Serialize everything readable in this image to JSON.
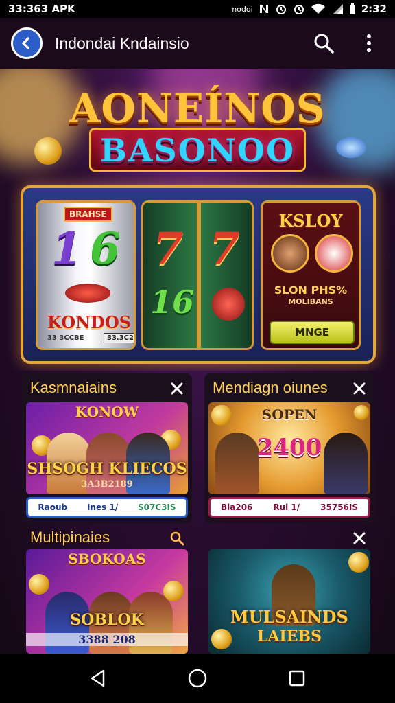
{
  "status_bar": {
    "left_text": "33:363 APK",
    "carrier": "nodoi",
    "time": "2:32"
  },
  "app_bar": {
    "title": "Indondai Kndainsio"
  },
  "hero": {
    "logo_line1": "AONEÍNOS",
    "logo_line2": "BASONOO",
    "reel1_label": "BRAHSE",
    "reel1_digits": [
      "1",
      "6"
    ],
    "reel1_caption": "KONDOS",
    "reel1_small1": "33 3CCBE",
    "reel1_small2": "33.3C2",
    "reel2_digits": [
      "7",
      "7",
      "16"
    ],
    "reel3_title": "KSLOY",
    "reel3_bonus": "SLON PHS%",
    "reel3_sub": "MOLIBANS",
    "reel3_button": "MNGE"
  },
  "cards": [
    {
      "title": "Kasmnaiains",
      "promo_top": "KONOW",
      "promo_main": "SHSOGH KLIECOS",
      "promo_sub": "3A3B2189",
      "foot": [
        "Raoub",
        "Ines 1/",
        "S07C3IS"
      ]
    },
    {
      "title": "Mendiagn oiunes",
      "promo_top": "SOPEN",
      "promo_main": "2400",
      "promo_sub": "",
      "foot": [
        "Bla206",
        "Rul 1/",
        "35756IS"
      ]
    },
    {
      "title": "Multipinaies",
      "promo_top": "SBOKOAS",
      "promo_main": "SOBLOK",
      "promo_sub": "3388 208"
    },
    {
      "title": "",
      "promo_top": "",
      "promo_main": "MULSAINDS",
      "promo_sub": "LAIEBS"
    }
  ],
  "colors": {
    "accent": "#ffd15a",
    "app_bar": "#1b0a1c",
    "back_button": "#2b5cc7"
  }
}
